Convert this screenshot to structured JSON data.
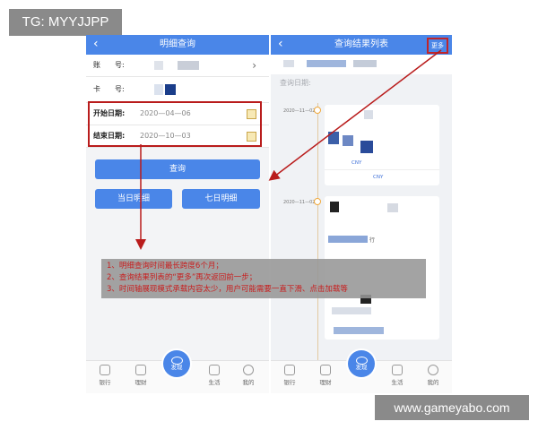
{
  "watermarks": {
    "top_left": "TG: MYYJJPP",
    "bottom_right": "www.gameyabo.com"
  },
  "left_screen": {
    "title": "明细查询",
    "fields": {
      "account_label": "账　　号:",
      "card_label": "卡　　号:",
      "start_label": "开始日期:",
      "start_value": "2020—04—06",
      "end_label": "结束日期:",
      "end_value": "2020—10—03"
    },
    "buttons": {
      "query": "查询",
      "today": "当日明细",
      "seven_days": "七日明细"
    }
  },
  "right_screen": {
    "title": "查询结果列表",
    "more_label": "更多",
    "query_date_label": "查询日期:",
    "timeline": [
      {
        "date": "2020—11—02",
        "currency": "CNY",
        "currency2": "CNY"
      },
      {
        "date": "2020—11—02",
        "fragment": "行"
      }
    ]
  },
  "tabbar": {
    "items": [
      {
        "label": "银行",
        "icon": "bank-icon"
      },
      {
        "label": "理财",
        "icon": "wealth-icon"
      },
      {
        "label": "发现",
        "icon": "eye-icon"
      },
      {
        "label": "生活",
        "icon": "life-icon"
      },
      {
        "label": "我的",
        "icon": "user-icon"
      }
    ]
  },
  "annotation": {
    "lines": [
      "1、明细查询时间最长跨度6个月；",
      "2、查询结果列表的“更多”再次返回前一步；",
      "3、时间轴展现模式承载内容太少，用户可能需要一直下滑、点击加载等"
    ]
  },
  "colors": {
    "accent": "#4a86e8",
    "annotation": "#c81e1e",
    "box": "#b91c1c"
  }
}
